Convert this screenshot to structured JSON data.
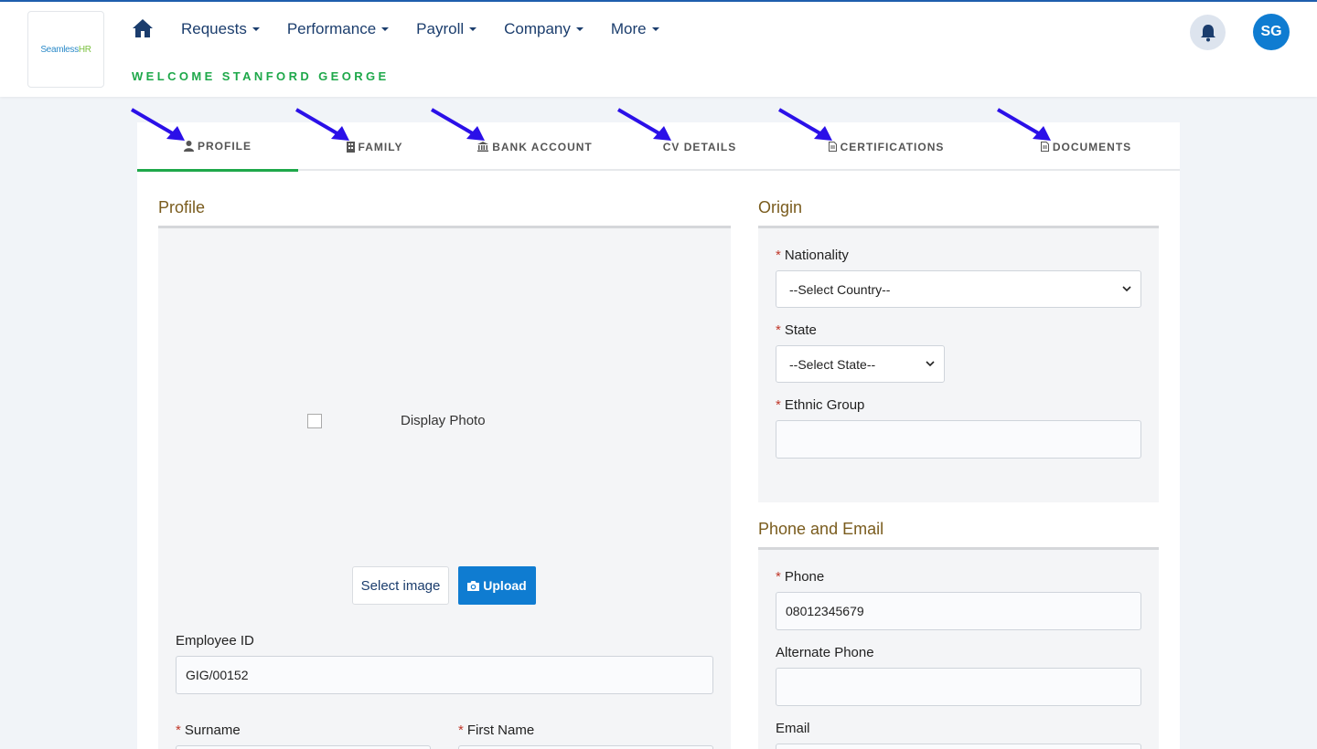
{
  "brand": {
    "logo_part1": "Seamless",
    "logo_part2": "HR",
    "accent": "#0f7cd1",
    "green": "#1ea84a",
    "section_color": "#7a5c1e"
  },
  "nav": {
    "items": [
      {
        "label": "Requests"
      },
      {
        "label": "Performance"
      },
      {
        "label": "Payroll"
      },
      {
        "label": "Company"
      },
      {
        "label": "More"
      }
    ],
    "welcome": "WELCOME STANFORD GEORGE",
    "avatar_initials": "SG"
  },
  "tabs": [
    {
      "label": "PROFILE",
      "icon": "user-icon",
      "active": true
    },
    {
      "label": "FAMILY",
      "icon": "building-icon"
    },
    {
      "label": "BANK ACCOUNT",
      "icon": "bank-icon"
    },
    {
      "label": "CV DETAILS",
      "icon": ""
    },
    {
      "label": "CERTIFICATIONS",
      "icon": "file-icon"
    },
    {
      "label": "DOCUMENTS",
      "icon": "file-icon"
    }
  ],
  "profile": {
    "title": "Profile",
    "photo_alt": "Display Photo",
    "select_image_label": "Select image",
    "upload_label": "Upload",
    "employee_id_label": "Employee ID",
    "employee_id_value": "GIG/00152",
    "surname_label": "Surname",
    "first_name_label": "First Name"
  },
  "origin": {
    "title": "Origin",
    "nationality_label": "Nationality",
    "nationality_value": "--Select Country--",
    "state_label": "State",
    "state_value": "--Select State--",
    "ethnic_label": "Ethnic Group",
    "ethnic_value": ""
  },
  "contact": {
    "title": "Phone and Email",
    "phone_label": "Phone",
    "phone_value": "08012345679",
    "alt_phone_label": "Alternate Phone",
    "alt_phone_value": "",
    "email_label": "Email"
  },
  "required_mark": "*"
}
